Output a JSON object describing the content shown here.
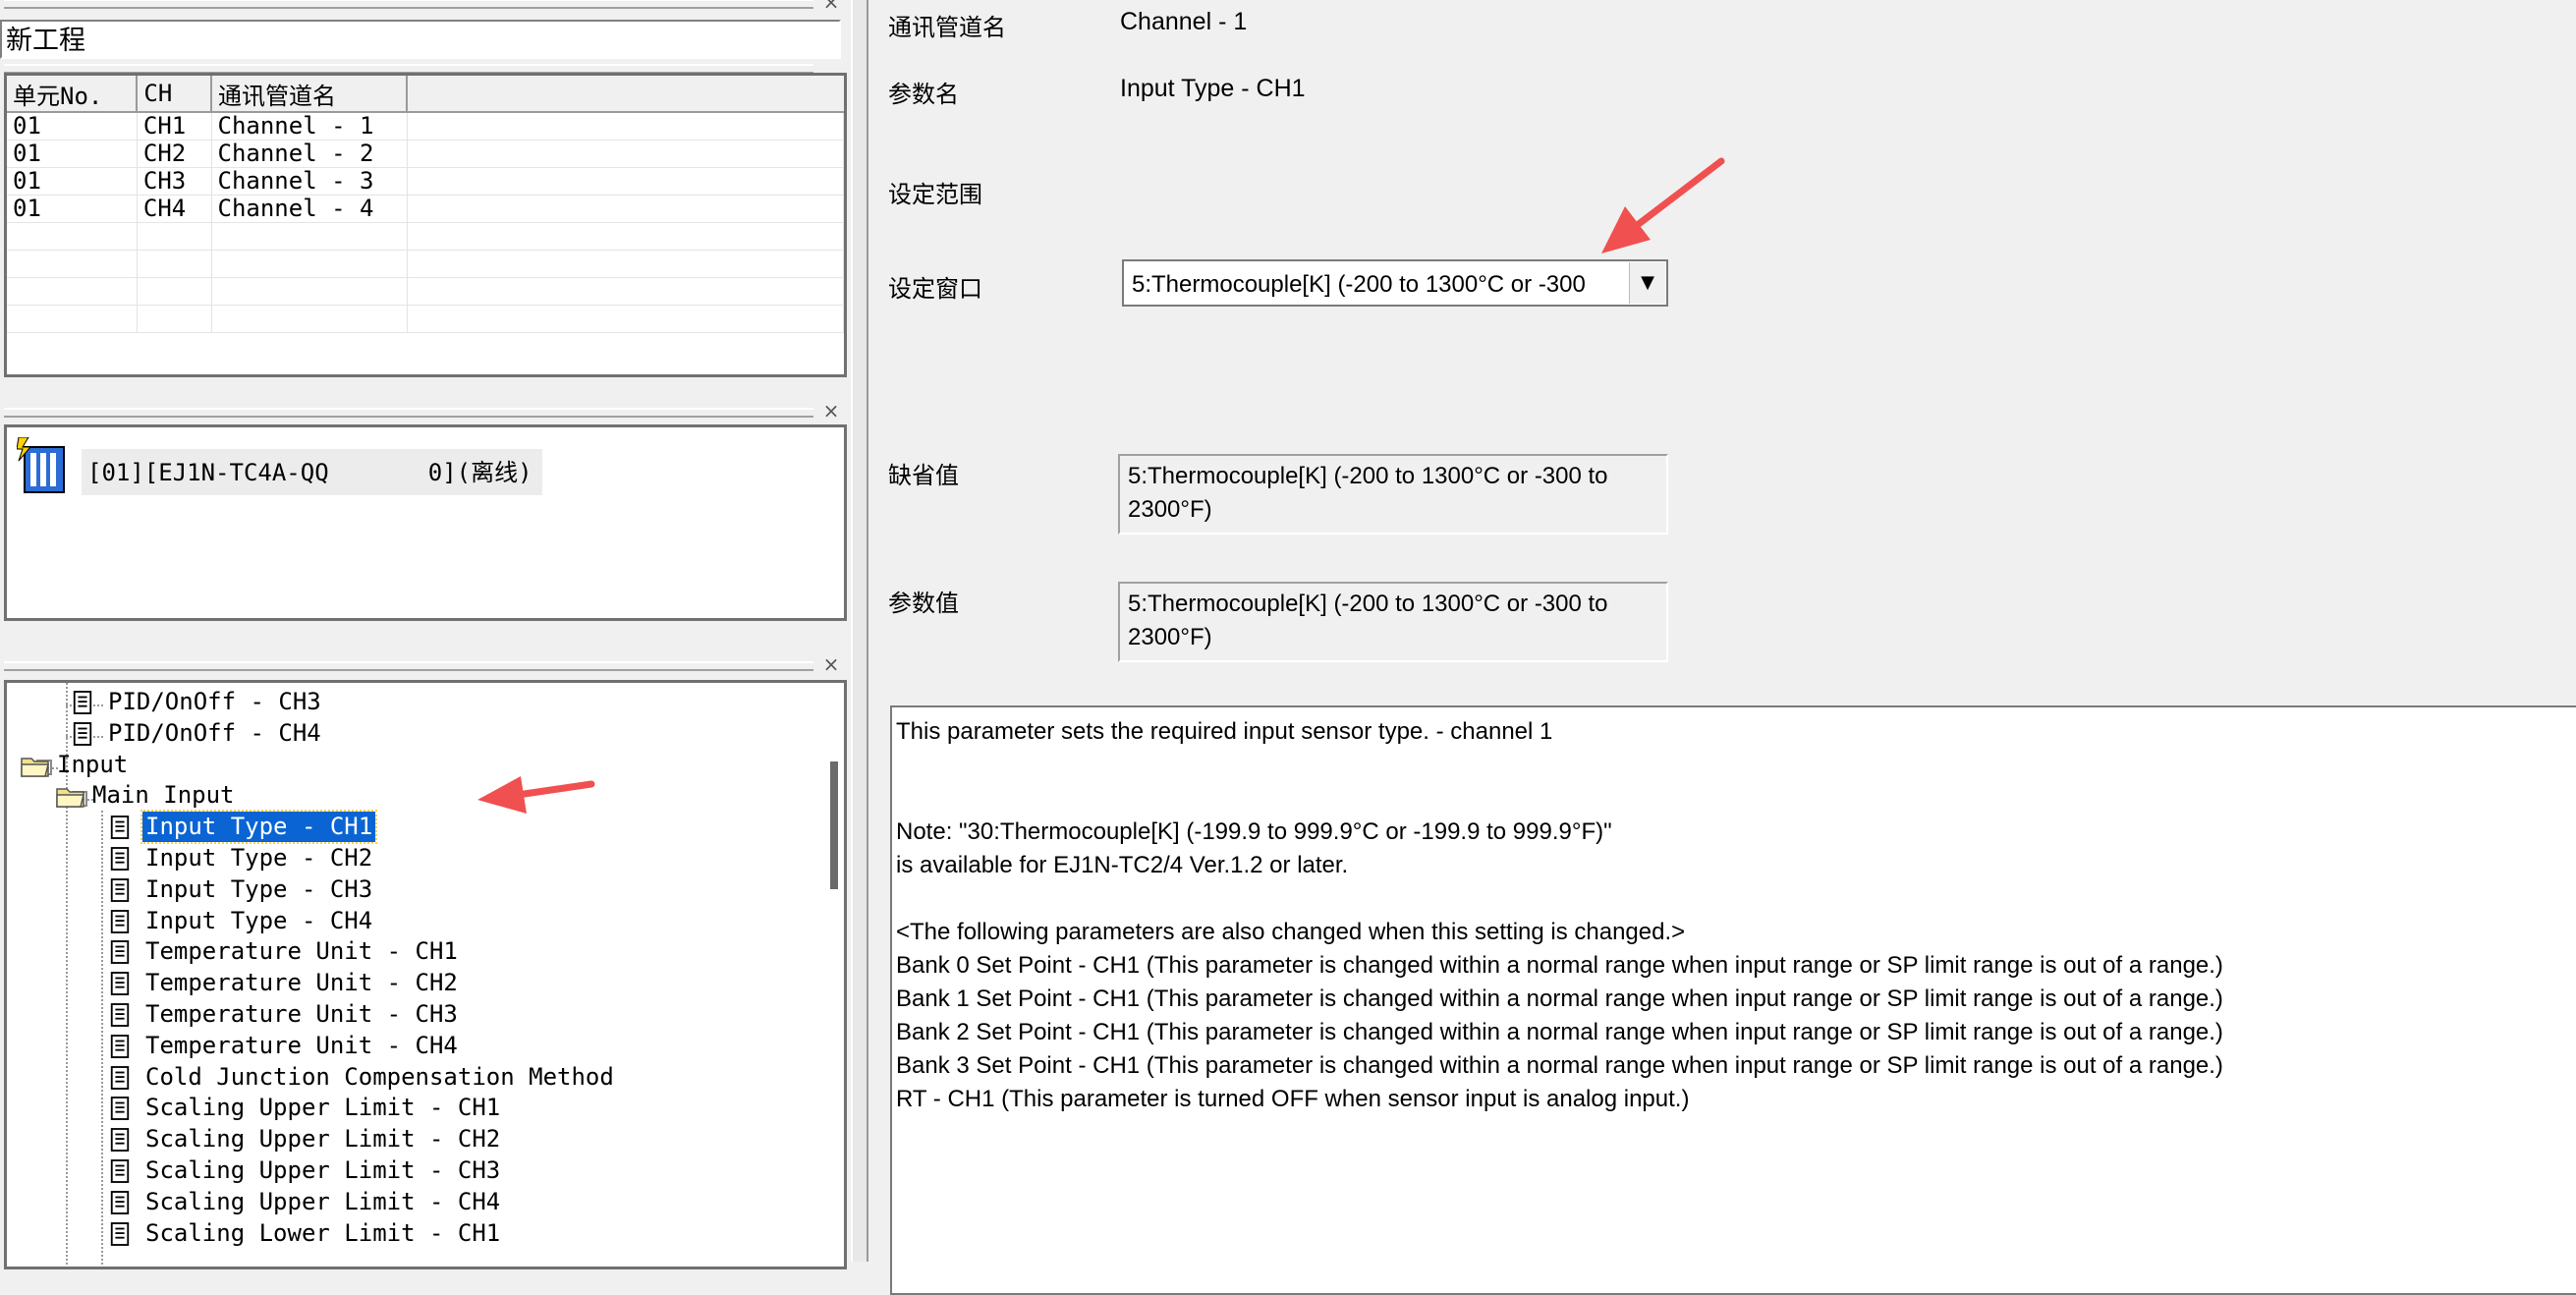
{
  "project": {
    "title": "新工程"
  },
  "channel_table": {
    "headers": [
      "单元No.",
      "CH",
      "通讯管道名"
    ],
    "rows": [
      [
        "01",
        "CH1",
        "Channel - 1"
      ],
      [
        "01",
        "CH2",
        "Channel - 2"
      ],
      [
        "01",
        "CH3",
        "Channel - 3"
      ],
      [
        "01",
        "CH4",
        "Channel - 4"
      ]
    ]
  },
  "device": {
    "label": "[01][EJ1N-TC4A-QQ       0](离线)"
  },
  "tree": {
    "items": [
      "PID/OnOff - CH3",
      "PID/OnOff - CH4",
      "Input",
      "Main Input",
      "Input Type - CH1",
      "Input Type - CH2",
      "Input Type - CH3",
      "Input Type - CH4",
      "Temperature Unit - CH1",
      "Temperature Unit - CH2",
      "Temperature Unit - CH3",
      "Temperature Unit - CH4",
      "Cold Junction Compensation Method",
      "Scaling Upper Limit - CH1",
      "Scaling Upper Limit - CH2",
      "Scaling Upper Limit - CH3",
      "Scaling Upper Limit - CH4",
      "Scaling Lower Limit - CH1"
    ],
    "selected_index": 4
  },
  "params": {
    "channel_label": "通讯管道名",
    "channel_value": "Channel - 1",
    "name_label": "参数名",
    "name_value": "Input Type - CH1",
    "range_label": "设定范围",
    "window_label": "设定窗口",
    "window_value": "5:Thermocouple[K] (-200 to 1300°C or -300",
    "default_label": "缺省值",
    "default_value": "5:Thermocouple[K] (-200 to 1300°C or -300 to 2300°F)",
    "param_label": "参数值",
    "param_value": "5:Thermocouple[K] (-200 to 1300°C or -300 to 2300°F)"
  },
  "description": [
    "This parameter sets the required input sensor type. - channel 1",
    "",
    "",
    "Note: \"30:Thermocouple[K] (-199.9 to 999.9°C or -199.9 to 999.9°F)\"",
    "is available for EJ1N-TC2/4 Ver.1.2 or later.",
    "",
    "<The following parameters are also changed when this setting is changed.>",
    "Bank 0 Set Point - CH1 (This parameter is changed within a normal range when input range or SP limit range is out of a range.)",
    "Bank 1 Set Point - CH1 (This parameter is changed within a normal range when input range or SP limit range is out of a range.)",
    "Bank 2 Set Point - CH1 (This parameter is changed within a normal range when input range or SP limit range is out of a range.)",
    "Bank 3 Set Point - CH1 (This parameter is changed within a normal range when input range or SP limit range is out of a range.)",
    "RT - CH1 (This parameter is turned OFF when sensor input is analog input.)"
  ],
  "colors": {
    "selection": "#0a64d4",
    "annotation_arrow": "#f05050"
  }
}
